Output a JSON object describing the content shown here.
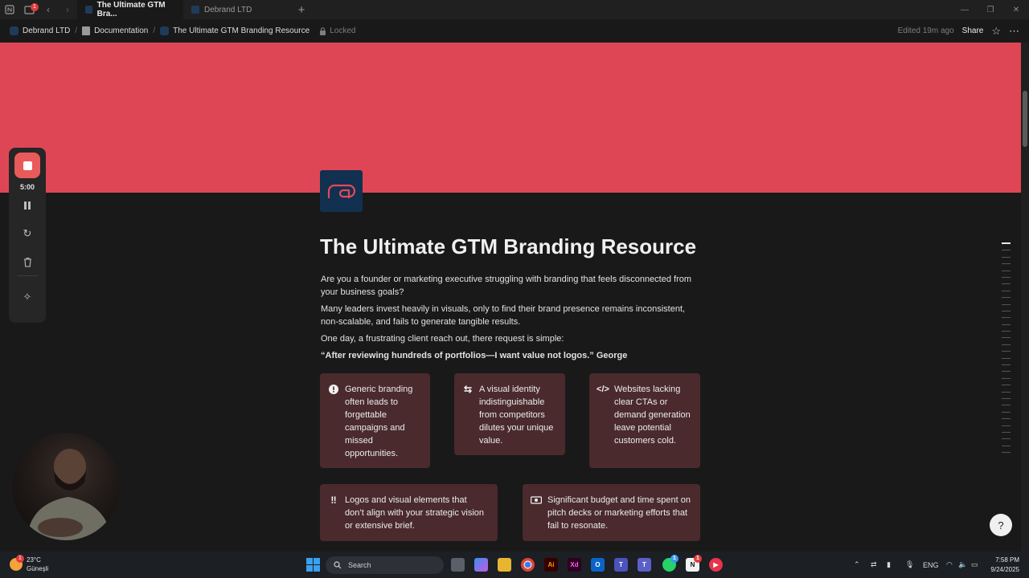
{
  "browser": {
    "tabs": [
      {
        "label": "The Ultimate GTM Bra...",
        "active": true
      },
      {
        "label": "Debrand LTD",
        "active": false
      }
    ],
    "tab_badge": "1"
  },
  "breadcrumb": {
    "items": [
      "Debrand LTD",
      "Documentation",
      "The Ultimate GTM Branding Resource"
    ],
    "locked": "Locked",
    "edited": "Edited 19m ago",
    "share": "Share"
  },
  "page": {
    "cover_color": "#de4656",
    "title": "The Ultimate GTM Branding Resource",
    "paragraphs": [
      "Are you a founder or marketing executive struggling with branding that feels disconnected from your business goals?",
      "Many leaders invest heavily in visuals, only to find their brand presence remains inconsistent, non-scalable, and fails to generate tangible results.",
      "One day, a frustrating client reach out, there request is simple:"
    ],
    "quote": "“After reviewing hundreds of portfolios—I want value not logos.” George",
    "cards": [
      {
        "icon": "exclamation-circle-icon",
        "text": "Generic branding often leads to forgettable campaigns and missed opportunities."
      },
      {
        "icon": "swap-arrows-icon",
        "text": "A visual identity indistinguishable from competitors dilutes your unique value."
      },
      {
        "icon": "code-icon",
        "text": "Websites lacking clear CTAs or demand generation leave potential customers cold."
      },
      {
        "icon": "double-exclamation-icon",
        "text": "Logos and visual elements that don’t align with your strategic vision or extensive brief."
      },
      {
        "icon": "money-icon",
        "text": "Significant budget and time spent on pitch decks or marketing efforts that fail to resonate."
      }
    ],
    "card_color": "#4a2a2d"
  },
  "recorder": {
    "time": "5:00"
  },
  "taskbar": {
    "weather_temp": "23°C",
    "weather_desc": "Güneşli",
    "weather_badge": "1",
    "search_placeholder": "Search",
    "lang": "ENG",
    "time": "7:58 PM",
    "date": "9/24/2025",
    "whatsapp_badge": "1",
    "notion_badge": "1"
  }
}
